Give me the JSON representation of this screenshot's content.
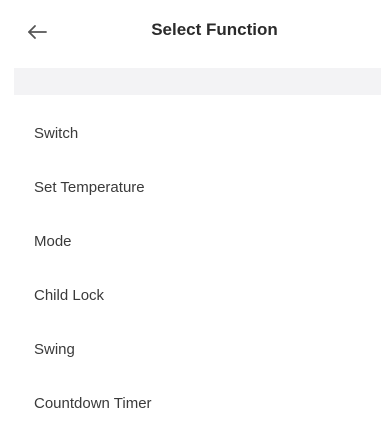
{
  "header": {
    "title": "Select Function",
    "back_icon": "arrow-left-icon"
  },
  "functions": [
    {
      "label": "Switch"
    },
    {
      "label": "Set Temperature"
    },
    {
      "label": "Mode"
    },
    {
      "label": "Child Lock"
    },
    {
      "label": "Swing"
    },
    {
      "label": "Countdown Timer"
    }
  ],
  "colors": {
    "background": "#ffffff",
    "divider_band": "#f3f3f5",
    "text": "#3a3a3a",
    "title": "#2b2b2b"
  }
}
